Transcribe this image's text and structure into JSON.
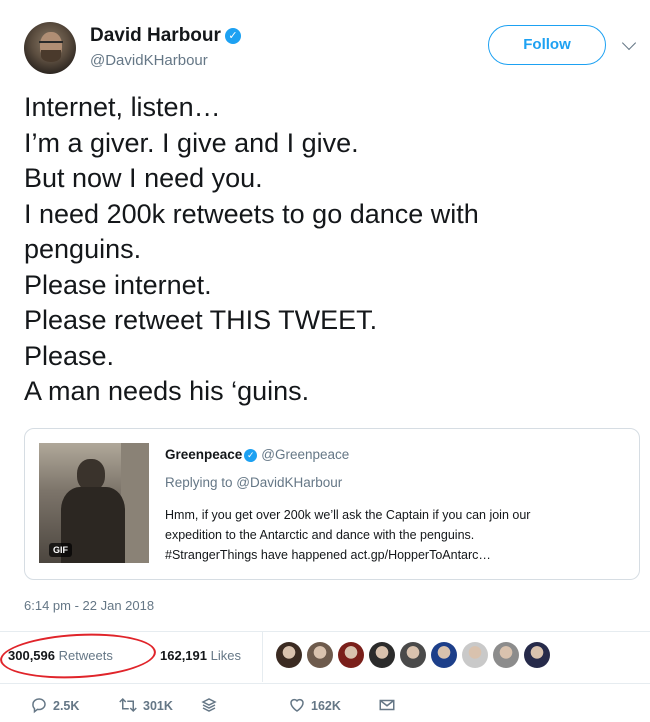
{
  "author": {
    "name": "David Harbour",
    "handle": "@DavidKHarbour",
    "verified_mark": "✓",
    "avatar_icon": "profile-photo"
  },
  "follow_label": "Follow",
  "tweet_lines": [
    "Internet, listen…",
    "I’m a giver.  I give and I give.",
    "But now I need you.",
    "I need 200k retweets to go dance with",
    "penguins.",
    "Please internet.",
    "Please retweet THIS TWEET.",
    "Please.",
    "A man needs his ‘guins."
  ],
  "quote": {
    "name": "Greenpeace",
    "handle": "@Greenpeace",
    "verified_mark": "✓",
    "reply_to": "Replying to @DavidKHarbour",
    "body_lines": [
      "Hmm, if you get over 200k we’ll ask the Captain if you can join our",
      "expedition to the Antarctic and dance with the penguins.",
      "#StrangerThings have happened act.gp/HopperToAntarc…"
    ],
    "media_badge": "GIF"
  },
  "timestamp": "6:14 pm - 22 Jan 2018",
  "stats": {
    "retweets_count": "300,596",
    "retweets_label": "Retweets",
    "likes_count": "162,191",
    "likes_label": "Likes"
  },
  "liker_colors": [
    "#3b2b22",
    "#6d5a4c",
    "#7a1f1a",
    "#2b2b2b",
    "#4a4a4a",
    "#1d3f8a",
    "#c9c9c9",
    "#8c8c8c",
    "#262a4a"
  ],
  "actions": {
    "reply_count": "2.5K",
    "retweet_count": "301K",
    "like_count": "162K"
  },
  "colors": {
    "accent": "#1da1f2",
    "secondary_text": "#657786",
    "annotation_circle": "#e0242a"
  }
}
